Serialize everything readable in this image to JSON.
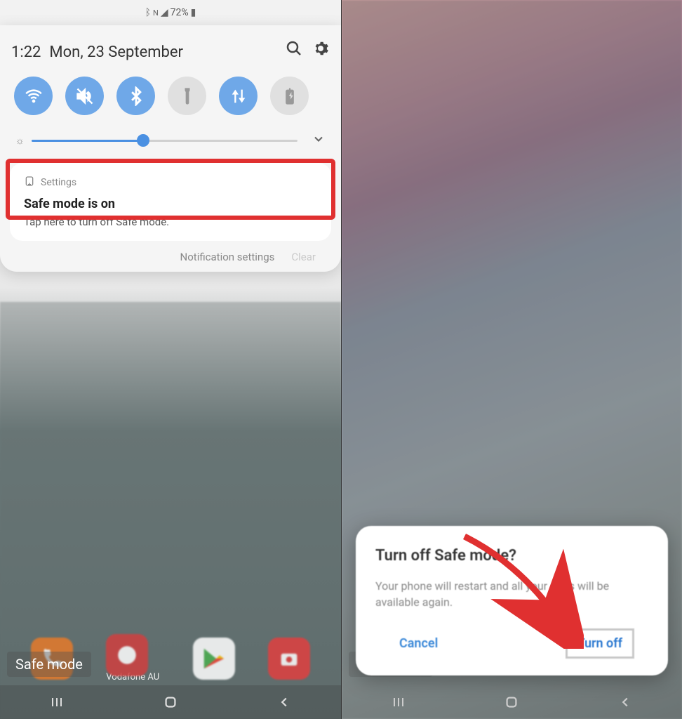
{
  "status": {
    "battery_text": "72%"
  },
  "panel": {
    "time": "1:22",
    "date": "Mon, 23 September"
  },
  "slider": {
    "percent": 42
  },
  "notification": {
    "source": "Settings",
    "title": "Safe mode is on",
    "body": "Tap here to turn off Safe mode.",
    "footer_settings": "Notification settings",
    "footer_clear": "Clear"
  },
  "dock": {
    "carrier": "Vodafone AU"
  },
  "safe_mode_label": "Safe mode",
  "modal": {
    "title": "Turn off Safe mode?",
    "body": "Your phone will restart and all your apps will be available again.",
    "cancel": "Cancel",
    "confirm": "Turn off"
  }
}
